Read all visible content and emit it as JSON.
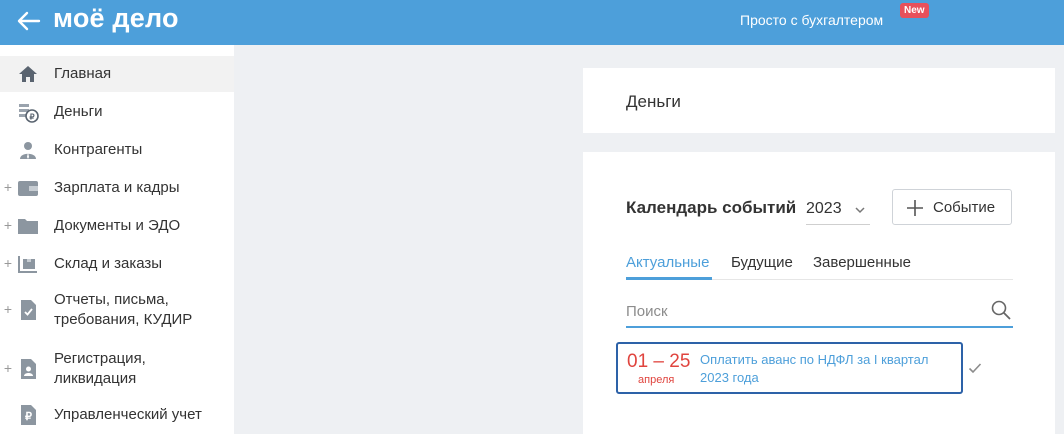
{
  "header": {
    "logo": "моё дело",
    "promo": "Просто с бухгалтером",
    "badge": "New"
  },
  "sidebar": {
    "items": [
      {
        "label": "Главная",
        "icon": "home-icon",
        "expandable": false,
        "active": true
      },
      {
        "label": "Деньги",
        "icon": "coins-icon",
        "expandable": false
      },
      {
        "label": "Контрагенты",
        "icon": "person-icon",
        "expandable": false
      },
      {
        "label": "Зарплата и кадры",
        "icon": "wallet-icon",
        "expandable": true
      },
      {
        "label": "Документы и ЭДО",
        "icon": "folder-icon",
        "expandable": true
      },
      {
        "label": "Склад и заказы",
        "icon": "warehouse-icon",
        "expandable": true
      },
      {
        "label": "Отчеты, письма,",
        "label2": "требования, КУДИР",
        "icon": "report-icon",
        "expandable": true
      },
      {
        "label": "Регистрация,",
        "label2": "ликвидация",
        "icon": "registration-icon",
        "expandable": true
      },
      {
        "label": "Управленческий учет",
        "icon": "ruble-icon",
        "expandable": false
      }
    ],
    "plus_symbol": "+"
  },
  "main": {
    "section_title": "Деньги",
    "calendar": {
      "title": "Календарь событий",
      "year": "2023",
      "add_button": "Событие",
      "tabs": [
        {
          "label": "Актуальные",
          "active": true
        },
        {
          "label": "Будущие",
          "active": false
        },
        {
          "label": "Завершенные",
          "active": false
        }
      ],
      "search_placeholder": "Поиск",
      "events": [
        {
          "date": "01 – 25",
          "month": "апреля",
          "text": "Оплатить аванс по НДФЛ за I квартал 2023 года"
        }
      ]
    }
  },
  "colors": {
    "topbar": "#4d9fda",
    "accent": "#4d9fda",
    "badge": "#e8505b",
    "date": "#e0443e",
    "event_border": "#2d62a8"
  }
}
